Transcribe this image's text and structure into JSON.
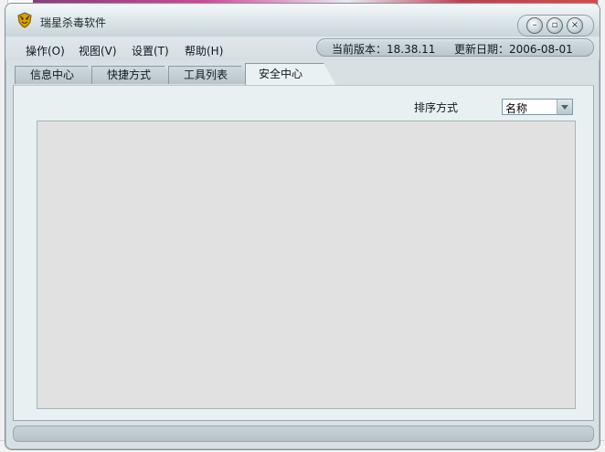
{
  "window": {
    "title": "瑞星杀毒软件"
  },
  "menu": {
    "items": [
      {
        "label": "操作(O)"
      },
      {
        "label": "视图(V)"
      },
      {
        "label": "设置(T)"
      },
      {
        "label": "帮助(H)"
      }
    ]
  },
  "version": {
    "current": "当前版本：18.38.11",
    "updated": "更新日期：2006-08-01"
  },
  "tabs": [
    {
      "label": "信息中心",
      "active": false
    },
    {
      "label": "快捷方式",
      "active": false
    },
    {
      "label": "工具列表",
      "active": false
    },
    {
      "label": "安全中心",
      "active": true
    }
  ],
  "sort": {
    "label": "排序方式",
    "selected": "名称"
  },
  "colors": {
    "accent": "#d7e0e3",
    "content_bg": "#e9f0f1",
    "list_bg": "#e1e1e1"
  },
  "icons": {
    "app": "tiger-shield-icon",
    "minimize": "minimize-icon",
    "maximize": "maximize-icon",
    "close": "close-icon",
    "dropdown": "chevron-down-icon"
  }
}
